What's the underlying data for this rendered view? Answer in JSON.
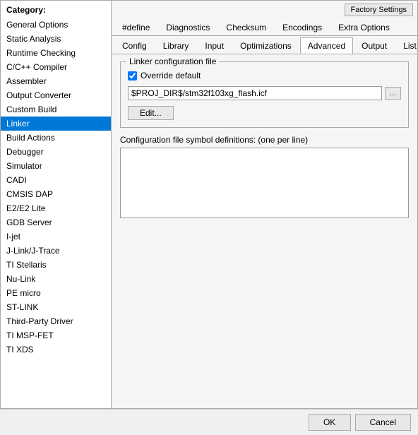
{
  "dialog": {
    "category_label": "Category:",
    "factory_settings": "Factory Settings",
    "ok": "OK",
    "cancel": "Cancel"
  },
  "sidebar": {
    "items": [
      {
        "id": "general-options",
        "label": "General Options",
        "selected": false
      },
      {
        "id": "static-analysis",
        "label": "Static Analysis",
        "selected": false
      },
      {
        "id": "runtime-checking",
        "label": "Runtime Checking",
        "selected": false
      },
      {
        "id": "c-cpp-compiler",
        "label": "C/C++ Compiler",
        "selected": false
      },
      {
        "id": "assembler",
        "label": "Assembler",
        "selected": false
      },
      {
        "id": "output-converter",
        "label": "Output Converter",
        "selected": false
      },
      {
        "id": "custom-build",
        "label": "Custom Build",
        "selected": false
      },
      {
        "id": "linker",
        "label": "Linker",
        "selected": true
      },
      {
        "id": "build-actions",
        "label": "Build Actions",
        "selected": false
      },
      {
        "id": "debugger",
        "label": "Debugger",
        "selected": false
      },
      {
        "id": "simulator",
        "label": "Simulator",
        "selected": false
      },
      {
        "id": "cadi",
        "label": "CADI",
        "selected": false
      },
      {
        "id": "cmsis-dap",
        "label": "CMSIS DAP",
        "selected": false
      },
      {
        "id": "e2-e2-lite",
        "label": "E2/E2 Lite",
        "selected": false
      },
      {
        "id": "gdb-server",
        "label": "GDB Server",
        "selected": false
      },
      {
        "id": "i-jet",
        "label": "I-jet",
        "selected": false
      },
      {
        "id": "j-link-j-trace",
        "label": "J-Link/J-Trace",
        "selected": false
      },
      {
        "id": "ti-stellaris",
        "label": "TI Stellaris",
        "selected": false
      },
      {
        "id": "nu-link",
        "label": "Nu-Link",
        "selected": false
      },
      {
        "id": "pe-micro",
        "label": "PE micro",
        "selected": false
      },
      {
        "id": "st-link",
        "label": "ST-LINK",
        "selected": false
      },
      {
        "id": "third-party-driver",
        "label": "Third-Party Driver",
        "selected": false
      },
      {
        "id": "ti-msp-fet",
        "label": "TI MSP-FET",
        "selected": false
      },
      {
        "id": "ti-xds",
        "label": "TI XDS",
        "selected": false
      }
    ]
  },
  "tabs_row1": [
    {
      "id": "define",
      "label": "#define",
      "active": false
    },
    {
      "id": "diagnostics",
      "label": "Diagnostics",
      "active": false
    },
    {
      "id": "checksum",
      "label": "Checksum",
      "active": false
    },
    {
      "id": "encodings",
      "label": "Encodings",
      "active": false
    },
    {
      "id": "extra-options",
      "label": "Extra Options",
      "active": false
    }
  ],
  "tabs_row2": [
    {
      "id": "config",
      "label": "Config",
      "active": false
    },
    {
      "id": "library",
      "label": "Library",
      "active": false
    },
    {
      "id": "input",
      "label": "Input",
      "active": false
    },
    {
      "id": "optimizations",
      "label": "Optimizations",
      "active": false
    },
    {
      "id": "advanced",
      "label": "Advanced",
      "active": true
    },
    {
      "id": "output",
      "label": "Output",
      "active": false
    },
    {
      "id": "list",
      "label": "List",
      "active": false
    }
  ],
  "linker_config": {
    "group_title": "Linker configuration file",
    "override_default_label": "Override default",
    "override_default_checked": true,
    "file_path": "$PROJ_DIR$/stm32f103xg_flash.icf",
    "browse_btn": "...",
    "edit_btn": "Edit...",
    "symbols_label": "Configuration file symbol definitions: (one per line)"
  }
}
